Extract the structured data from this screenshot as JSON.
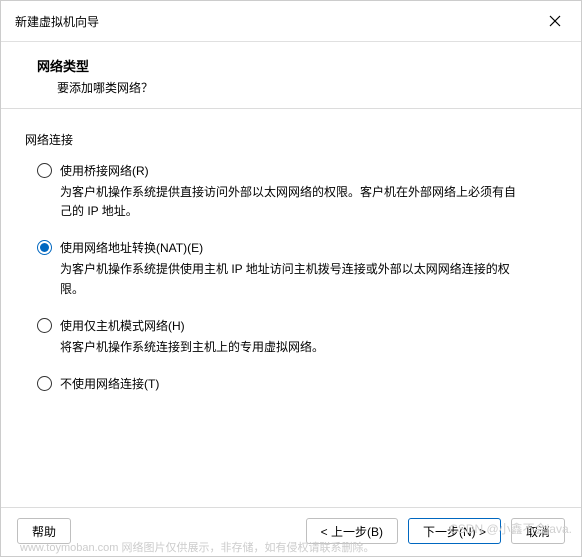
{
  "titlebar": {
    "title": "新建虚拟机向导"
  },
  "header": {
    "title": "网络类型",
    "subtitle": "要添加哪类网络？"
  },
  "section": {
    "label": "网络连接"
  },
  "options": {
    "bridged": {
      "label": "使用桥接网络(R)",
      "desc": "为客户机操作系统提供直接访问外部以太网网络的权限。客户机在外部网络上必须有自己的 IP 地址。"
    },
    "nat": {
      "label": "使用网络地址转换(NAT)(E)",
      "desc": "为客户机操作系统提供使用主机 IP 地址访问主机拨号连接或外部以太网网络连接的权限。"
    },
    "hostonly": {
      "label": "使用仅主机模式网络(H)",
      "desc": "将客户机操作系统连接到主机上的专用虚拟网络。"
    },
    "none": {
      "label": "不使用网络连接(T)"
    }
  },
  "buttons": {
    "help": "帮助",
    "back": "< 上一步(B)",
    "next": "下一步(N) >",
    "cancel": "取消"
  },
  "watermark": {
    "bottom": "www.toymoban.com 网络图片仅供展示，非存储，如有侵权请联系删除。",
    "right": "CSDN @小鑫不会java."
  }
}
